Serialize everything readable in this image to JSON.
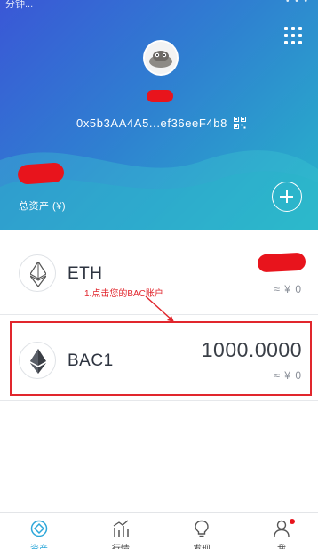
{
  "status_bar": {
    "carrier": "分钟...",
    "icons": "• • •"
  },
  "wallet": {
    "address": "0x5b3AA4A5...ef36eeF4b8",
    "total_assets_label": "总资产 (¥)"
  },
  "tokens": [
    {
      "symbol": "ETH",
      "balance": "",
      "fiat": "≈ ¥ 0"
    },
    {
      "symbol": "BAC1",
      "balance": "1000.0000",
      "fiat": "≈ ¥ 0"
    }
  ],
  "annotation": "1.点击您的BAC账户",
  "tabbar": {
    "items": [
      {
        "label": "资产",
        "icon": "wallet-icon",
        "active": true
      },
      {
        "label": "行情",
        "icon": "chart-icon",
        "active": false
      },
      {
        "label": "发现",
        "icon": "bulb-icon",
        "active": false
      },
      {
        "label": "我",
        "icon": "person-icon",
        "active": false
      }
    ]
  },
  "colors": {
    "header_start": "#3a57d6",
    "header_end": "#27b6c9",
    "accent": "#2da7d9",
    "annotation": "#e1262d",
    "redaction": "#e8141c"
  }
}
